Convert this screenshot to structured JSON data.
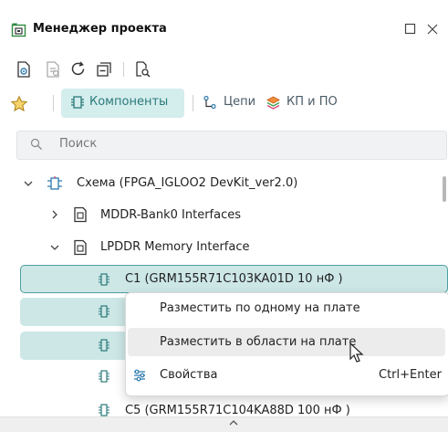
{
  "panel": {
    "title": "Менеджер проекта"
  },
  "tabs": [
    {
      "label": "Компоненты"
    },
    {
      "label": "Цепи"
    },
    {
      "label": "КП и ПО"
    }
  ],
  "search": {
    "placeholder": "Поиск"
  },
  "tree": {
    "root": "Схема (FPGA_IGLOO2 DevKit_ver2.0)",
    "items": [
      {
        "label": "MDDR-Bank0 Interfaces"
      },
      {
        "label": "LPDDR Memory Interface"
      },
      {
        "label": "C1 (GRM155R71C103KA01D 10 нФ  )"
      },
      {
        "label": "C5 (GRM155R71C104KA88D 100 нФ  )"
      }
    ]
  },
  "context_menu": {
    "items": [
      {
        "label": "Разместить по одному на плате",
        "shortcut": ""
      },
      {
        "label": "Разместить в области на плате",
        "shortcut": ""
      },
      {
        "label": "Свойства",
        "shortcut": "Ctrl+Enter"
      }
    ]
  },
  "colors": {
    "accent": "#2c9a9a",
    "selection": "#cde7e7",
    "selection_border": "#4e9f9f"
  }
}
